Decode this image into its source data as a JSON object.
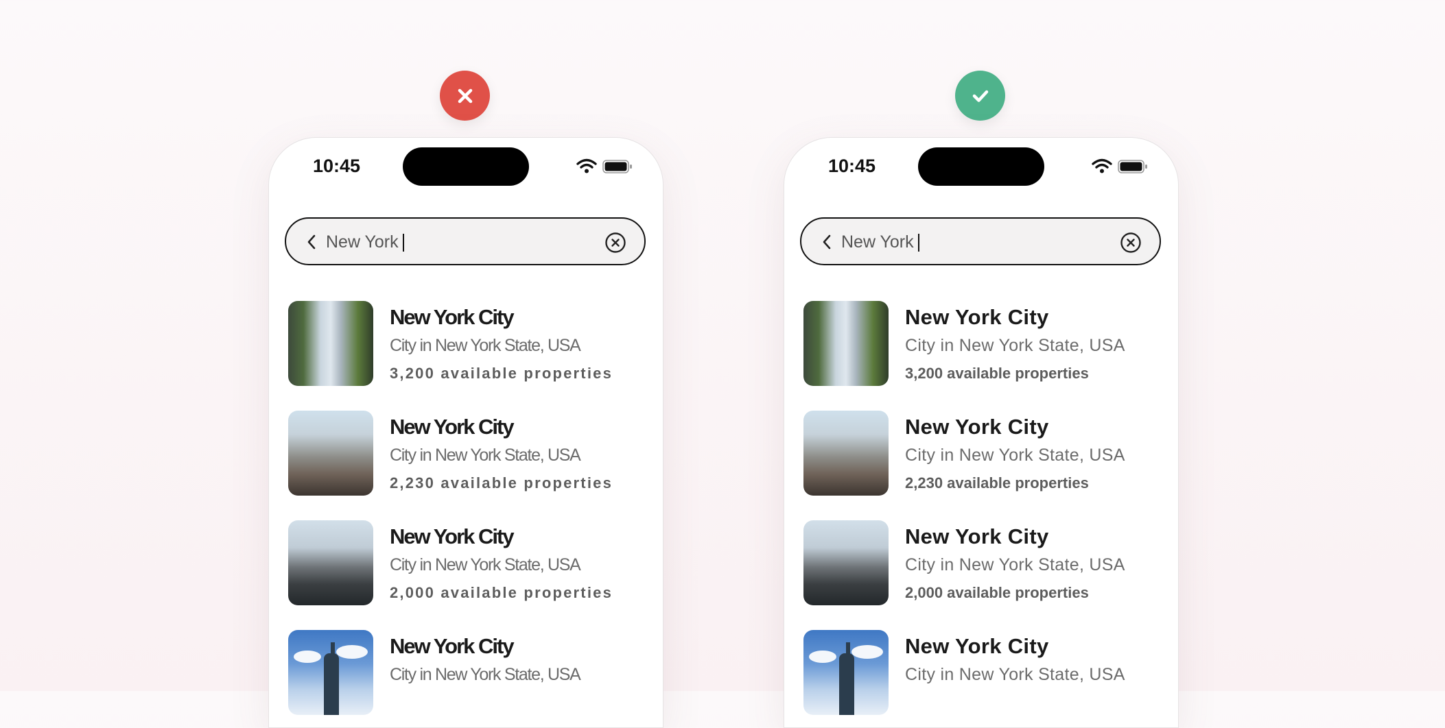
{
  "badges": {
    "bad": {
      "icon": "close-icon",
      "color": "#e05148"
    },
    "good": {
      "icon": "check-icon",
      "color": "#4fb38c"
    }
  },
  "status_bar": {
    "time": "10:45",
    "wifi_icon": "wifi-icon",
    "battery_icon": "battery-icon"
  },
  "search": {
    "value": "New York",
    "back_icon": "chevron-left-icon",
    "clear_icon": "clear-circle-icon"
  },
  "results": [
    {
      "title": "New York City",
      "subtitle": "City in New York State, USA",
      "properties": "3,200 available properties"
    },
    {
      "title": "New York City",
      "subtitle": "City in New York State, USA",
      "properties": "2,230 available properties"
    },
    {
      "title": "New York City",
      "subtitle": "City in New York State, USA",
      "properties": "2,000 available properties"
    },
    {
      "title": "New York City",
      "subtitle": "City in New York State, USA",
      "properties": ""
    }
  ]
}
